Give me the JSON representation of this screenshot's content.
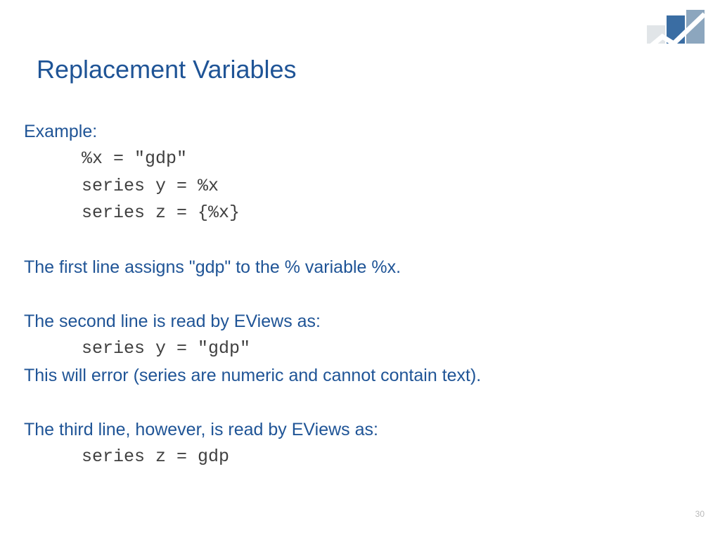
{
  "title": "Replacement Variables",
  "exampleLabel": "Example:",
  "code1": "%x = \"gdp\"",
  "code2": "series y = %x",
  "code3": "series z = {%x}",
  "para1": "The first line assigns \"gdp\" to the % variable %x.",
  "para2": "The second line is read by EViews as:",
  "code4": "series y = \"gdp\"",
  "para3": "This will error (series are numeric and cannot contain text).",
  "para4": "The third line, however, is read by EViews as:",
  "code5": "series z = gdp",
  "pageNumber": "30"
}
